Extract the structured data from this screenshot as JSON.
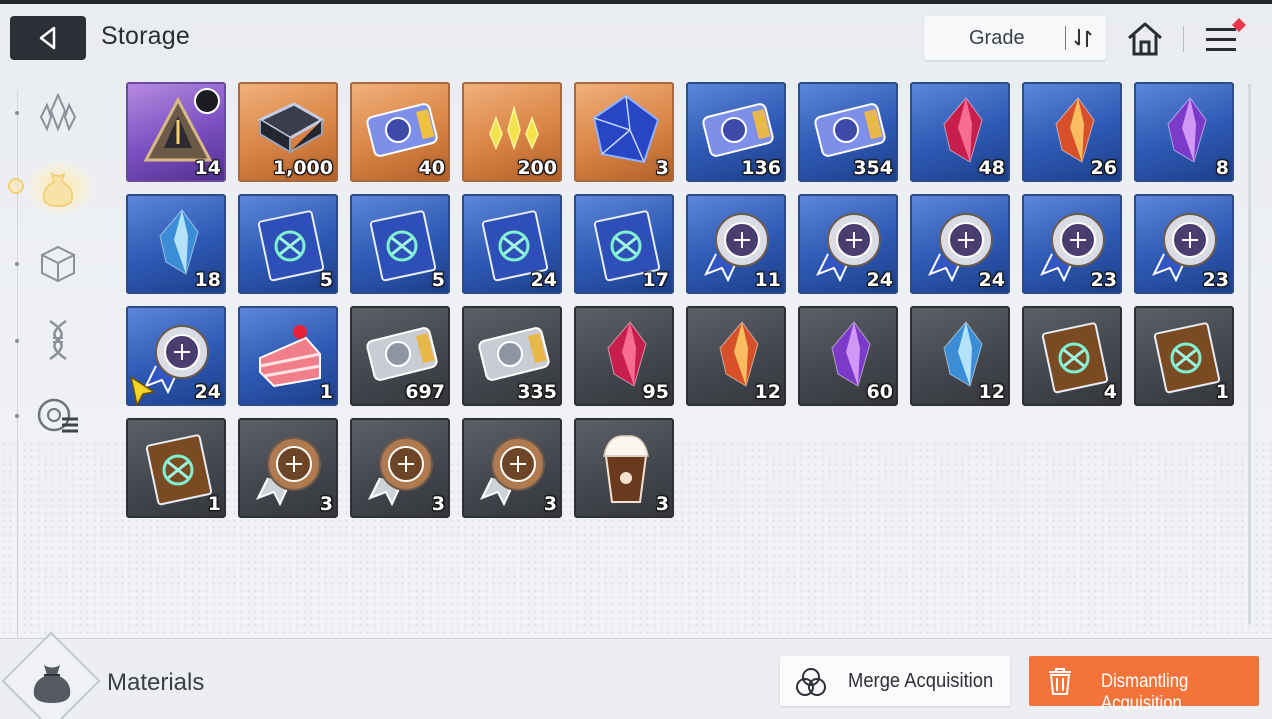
{
  "header": {
    "title": "Storage",
    "sort_label": "Grade",
    "back_icon": "back-arrow-icon",
    "home_icon": "home-icon",
    "menu_icon": "hamburger-menu-icon",
    "menu_badge_color": "#e8364a"
  },
  "sidebar": {
    "categories": [
      {
        "name": "crystal-category",
        "icon": "crystal-icon",
        "active": false
      },
      {
        "name": "materials-category",
        "icon": "pouch-icon",
        "active": true
      },
      {
        "name": "box-category",
        "icon": "cube-icon",
        "active": false
      },
      {
        "name": "gene-category",
        "icon": "dna-icon",
        "active": false
      },
      {
        "name": "other-category",
        "icon": "chip-list-icon",
        "active": false
      }
    ],
    "active_color": "#f3cf73"
  },
  "items": [
    {
      "count": "14",
      "rarity": "purple",
      "icon": "pyramid-core-icon",
      "timed": true
    },
    {
      "count": "1,000",
      "rarity": "orange",
      "icon": "data-chip-icon"
    },
    {
      "count": "40",
      "rarity": "orange",
      "icon": "gold-ticket-icon"
    },
    {
      "count": "200",
      "rarity": "orange",
      "icon": "gold-shards-icon"
    },
    {
      "count": "3",
      "rarity": "orange",
      "icon": "blue-cube-crystal-icon"
    },
    {
      "count": "136",
      "rarity": "blue",
      "icon": "character-ticket-icon"
    },
    {
      "count": "354",
      "rarity": "blue",
      "icon": "star-ticket-icon"
    },
    {
      "count": "48",
      "rarity": "blue",
      "icon": "red-crystal-icon"
    },
    {
      "count": "26",
      "rarity": "blue",
      "icon": "orange-crystal-icon"
    },
    {
      "count": "8",
      "rarity": "blue",
      "icon": "purple-crystal-icon"
    },
    {
      "count": "18",
      "rarity": "blue",
      "icon": "ice-crystal-icon"
    },
    {
      "count": "5",
      "rarity": "blue",
      "icon": "sword-book-icon"
    },
    {
      "count": "5",
      "rarity": "blue",
      "icon": "shield-book-icon"
    },
    {
      "count": "24",
      "rarity": "blue",
      "icon": "eye-book-icon"
    },
    {
      "count": "17",
      "rarity": "blue",
      "icon": "wing-book-icon"
    },
    {
      "count": "11",
      "rarity": "blue",
      "icon": "blade-medal-icon"
    },
    {
      "count": "24",
      "rarity": "blue",
      "icon": "shield-medal-icon"
    },
    {
      "count": "24",
      "rarity": "blue",
      "icon": "target-medal-icon"
    },
    {
      "count": "23",
      "rarity": "blue",
      "icon": "cross-medal-icon"
    },
    {
      "count": "23",
      "rarity": "blue",
      "icon": "bolt-medal-icon"
    },
    {
      "count": "24",
      "rarity": "blue",
      "icon": "orb-medal-icon"
    },
    {
      "count": "1",
      "rarity": "blue",
      "icon": "cake-slice-icon"
    },
    {
      "count": "697",
      "rarity": "dark",
      "icon": "silver-character-ticket-icon"
    },
    {
      "count": "335",
      "rarity": "dark",
      "icon": "silver-star-ticket-icon"
    },
    {
      "count": "95",
      "rarity": "dark",
      "icon": "pink-crystal-icon"
    },
    {
      "count": "12",
      "rarity": "dark",
      "icon": "amber-crystal-icon"
    },
    {
      "count": "60",
      "rarity": "dark",
      "icon": "violet-crystal-icon"
    },
    {
      "count": "12",
      "rarity": "dark",
      "icon": "cyan-crystal-icon"
    },
    {
      "count": "4",
      "rarity": "dark",
      "icon": "eye-tome-icon"
    },
    {
      "count": "1",
      "rarity": "dark",
      "icon": "wing-tome-icon"
    },
    {
      "count": "1",
      "rarity": "dark",
      "icon": "bolt-tome-icon"
    },
    {
      "count": "3",
      "rarity": "dark",
      "icon": "bronze-shield-medal-icon"
    },
    {
      "count": "3",
      "rarity": "dark",
      "icon": "bronze-target-medal-icon"
    },
    {
      "count": "3",
      "rarity": "dark",
      "icon": "bronze-orb-medal-icon"
    },
    {
      "count": "3",
      "rarity": "dark",
      "icon": "frappe-drink-icon"
    }
  ],
  "footer": {
    "category_label": "Materials",
    "category_icon": "pouch-icon",
    "merge_label": "Merge Acquisition",
    "merge_icon": "merge-circles-icon",
    "dismantle_label": "Dismantling Acquisition",
    "dismantle_icon": "trash-icon",
    "dismantle_color": "#f3733a"
  }
}
